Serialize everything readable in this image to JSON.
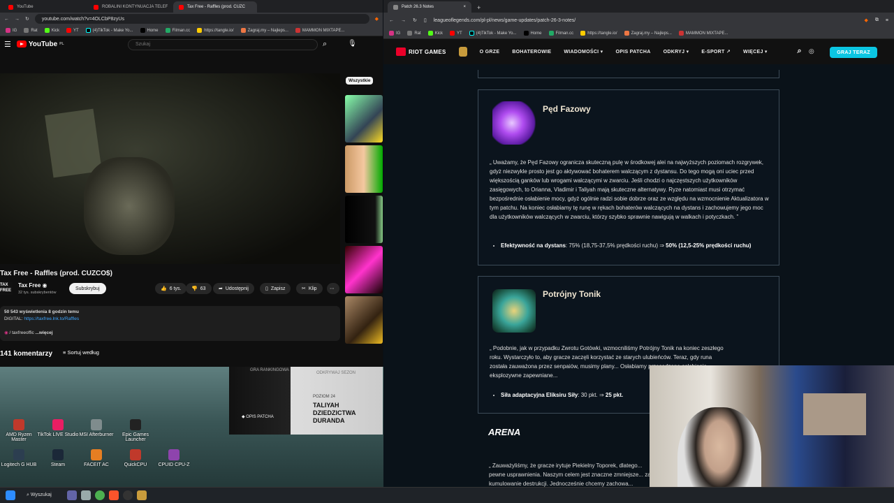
{
  "left_browser": {
    "tabs": [
      {
        "label": "YouTube",
        "active": false
      },
      {
        "label": "ROBALINI KONTYNUACJA TELEF",
        "active": false
      },
      {
        "label": "Tax Free - Raffles (prod. CUZC",
        "active": true
      }
    ],
    "url": "youtube.com/watch?v=4OLCbP8zyUs",
    "bookmarks": [
      "IG",
      "Rat",
      "Kick",
      "YT",
      "(4)TikTok - Make Yo...",
      "Home",
      "Filman.cc",
      "https://tangle.io/",
      "Zagraj.my – Najleps...",
      "MAMMON MIXTAPE..."
    ],
    "youtube": {
      "logo": "YouTube",
      "logo_region": "PL",
      "search_placeholder": "Szukaj",
      "chip": "Wszystkie",
      "video_title": "Tax Free - Raffles (prod. CUZCO$)",
      "channel_name": "Tax Free",
      "channel_subs": "32 tys. subskrybentów",
      "subscribe": "Subskrybuj",
      "likes": "6 tys.",
      "dislikes": "63",
      "share": "Udostępnij",
      "save": "Zapisz",
      "clip": "Klip",
      "views_line": "50 543 wyświetlenia  8 godzin temu",
      "digital_label": "DIGITAL:",
      "digital_link": "https://taxfree.lnk.to/Raffles",
      "instagram_line": "/ taxfreeoffic",
      "more": "...więcej",
      "comments_count": "141 komentarzy",
      "sort": "Sortuj według"
    }
  },
  "desktop_icons": [
    {
      "label": "AMD Ryzen Master",
      "color": "#c0392b"
    },
    {
      "label": "TikTok LIVE Studio",
      "color": "#e91e63"
    },
    {
      "label": "MSI Afterburner",
      "color": "#7f8c8d"
    },
    {
      "label": "Epic Games Launcher",
      "color": "#222222"
    },
    {
      "label": "Logitech G HUB",
      "color": "#2c3e50"
    },
    {
      "label": "Steam",
      "color": "#1b2838"
    },
    {
      "label": "FACEIT AC",
      "color": "#e67e22"
    },
    {
      "label": "QuickCPU",
      "color": "#c0392b"
    },
    {
      "label": "CPUID CPU-Z",
      "color": "#8e44ad"
    }
  ],
  "promo": {
    "rank": "GRA RANKINGOWA",
    "discover": "ODKRYWAJ SEZON",
    "level": "POZIOM 24",
    "heading": "TALIYAH DZIEDZICTWA DURANDA",
    "patch": "OPIS PATCHA"
  },
  "taskbar": {
    "search": "Wyszukaj"
  },
  "right_browser": {
    "tab": "Patch 26.3 Notes",
    "url": "leagueoflegends.com/pl-pl/news/game-updates/patch-26-3-notes/",
    "bookmarks": [
      "IG",
      "Rat",
      "Kick",
      "YT",
      "(4)TikTok - Make Yo...",
      "Home",
      "Filman.cc",
      "https://tangle.io/",
      "Zagraj.my – Najleps...",
      "MAMMON MIXTAPE..."
    ],
    "nav": {
      "brand": "RIOT GAMES",
      "items": [
        "O GRZE",
        "BOHATEROWIE",
        "WIADOMOŚCI",
        "OPIS PATCHA",
        "ODKRYJ",
        "E-SPORT",
        "WIĘCEJ"
      ],
      "play": "GRAJ TERAZ"
    },
    "card1": {
      "title": "Pęd Fazowy",
      "text": "Uważamy, że Pęd Fazowy ogranicza skuteczną pulę w środkowej alei na najwyższych poziomach rozgrywek, gdyż niezwykle prosto jest go aktywować bohaterem walczącym z dystansu. Do tego mogą oni uciec przed większością ganków lub wrogami walczącymi w zwarciu. Jeśli chodzi o najczęstszych użytkowników zasięgowych, to Orianna, Vladimir i Taliyah mają skuteczne alternatywy. Ryze natomiast musi otrzymać bezpośrednie osłabienie mocy, gdyż ogólnie radzi sobie dobrze oraz ze względu na wzmocnienie Aktualizatora w tym patchu. Na koniec osłabiamy tę runę w rękach bohaterów walczących na dystans i zachowujemy jego moc dla użytkowników walczących w zwarciu, którzy szybko sprawnie nawigują w walkach i potyczkach.",
      "bullet_label": "Efektywność na dystans",
      "bullet_old": ": 75% (18,75-37,5% prędkości ruchu) ⇒ ",
      "bullet_new": "50% (12,5-25% prędkości ruchu)"
    },
    "card2": {
      "title": "Potrójny Tonik",
      "text": "Podobnie, jak w przypadku Zwrotu Gotówki, wzmocniliśmy Potrójny Tonik na koniec zeszłego roku. Wystarczyło to, aby gracze zaczęli korzystać ze starych ulubieńców. Teraz, gdy runa została zauważona przez senpaiów, musimy plany... Osłabiamy przesadzone osłabienia eksplozywne zapewniane...",
      "bullet_label": "Siła adaptacyjna Eliksiru Siły",
      "bullet_old": ": 30 pkt. ⇒ ",
      "bullet_new": "25 pkt."
    },
    "arena_heading": "ARENA",
    "arena_text": "Zauważyliśmy, że gracze irytuje Piekielny Toporek, dlatego... pewne usprawnienia. Naszym celem jest znaczne zmniejsze... za kumulowanie destrukcji. Jednocześnie chcemy zachowa..."
  }
}
